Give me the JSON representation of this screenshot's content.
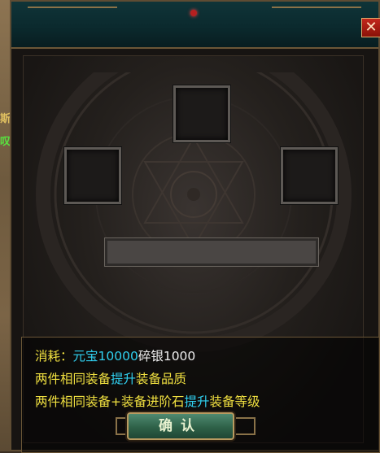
{
  "background": {
    "edge_text_1": "斯",
    "edge_text_2": "叹",
    "edge_text_1_color": "#e0c060",
    "edge_text_2_color": "#58e040"
  },
  "window": {
    "close_icon_glyph": "✕"
  },
  "slots": [
    {
      "name": "equipment-slot-top",
      "state": "empty"
    },
    {
      "name": "equipment-slot-left",
      "state": "empty"
    },
    {
      "name": "equipment-slot-right",
      "state": "empty"
    }
  ],
  "progress": {
    "fraction": 0
  },
  "info": {
    "cost_label": "消耗：",
    "cost_item1": "元宝10000",
    "cost_item2": "碎银1000",
    "line2_prefix": "两件相同装备",
    "line2_highlight": "提升",
    "line2_suffix": "装备品质",
    "line3_prefix": "两件相同装备+装备进阶石",
    "line3_highlight": "提升",
    "line3_suffix": "装备等级"
  },
  "confirm_button": {
    "label": "确认"
  },
  "colors": {
    "label_yellow": "#f0e040",
    "highlight_cyan": "#30d0f0",
    "text_white": "#f0f0f0",
    "close_red": "#c2281c"
  }
}
